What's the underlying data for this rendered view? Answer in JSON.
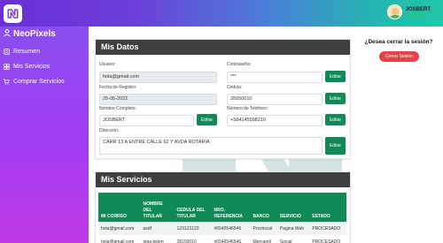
{
  "brand": {
    "name": "NeoPixels"
  },
  "user": {
    "name": "JOSBERT",
    "status": "Conectado"
  },
  "sidebar": {
    "items": [
      {
        "label": "Resumen",
        "icon": "user-icon"
      },
      {
        "label": "Mis Servicios",
        "icon": "grid-icon"
      },
      {
        "label": "Comprar Servicios",
        "icon": "cart-icon"
      }
    ]
  },
  "mis_datos": {
    "title": "Mis Datos",
    "usuario_label": "Usuario:",
    "usuario_value": "hola@gmail.com",
    "contrasena_label": "Contraseña:",
    "contrasena_value": "***",
    "fecha_label": "Fecha de Registro:",
    "fecha_value": "25-05-2022",
    "cedula_label": "Cédula:",
    "cedula_value": "28150010",
    "nombre_label": "Nombre Completo:",
    "nombre_value": "JOSBERT",
    "telefono_label": "Número de Teléfono:",
    "telefono_value": "+584145598216",
    "direccion_label": "Dirección:",
    "direccion_value": "CARR 13 A ENTRE CALLE 62 Y AVDA ROTARIA",
    "edit_label": "Editar"
  },
  "logout": {
    "question": "¿Desea cerrar la sesión?",
    "button": "Cerrar Sesion"
  },
  "mis_servicios": {
    "title": "Mis Servicios",
    "columns": [
      "MI CORREO",
      "NOMBRE DEL TITULAR",
      "CEDULA DEL TITULAR",
      "NRO. REFERENCIA",
      "BANCO",
      "SERVICIO",
      "ESTADO"
    ],
    "rows": [
      [
        "hola@gmail.com",
        "asdf",
        "123123123",
        "#6546546546",
        "Provincial",
        "Pagina Web",
        "PROCESADO"
      ],
      [
        "hola@gmail.com",
        "olga belen",
        "28150010",
        "#6546546546",
        "Mercantil",
        "Social",
        "PROCESADO"
      ]
    ]
  },
  "colors": {
    "accent": "#0f8a57",
    "danger": "#e8414a",
    "header": "#3f3f3f"
  }
}
